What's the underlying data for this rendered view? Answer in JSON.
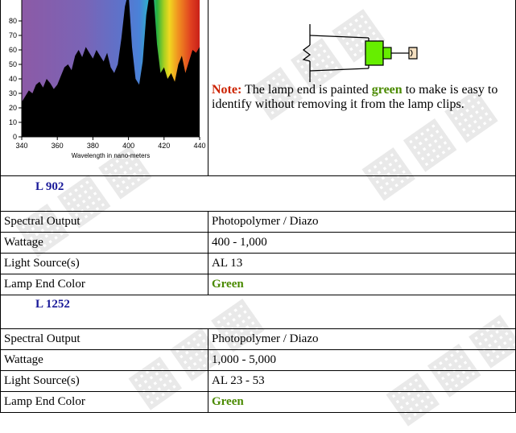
{
  "chart_data": {
    "type": "area",
    "title": "",
    "xlabel": "Wavelength in nano-meters",
    "ylabel": "",
    "xlim": [
      340,
      440
    ],
    "ylim": [
      0,
      100
    ],
    "xticks": [
      340,
      360,
      380,
      400,
      420,
      440
    ],
    "yticks": [
      0,
      10,
      20,
      30,
      40,
      50,
      60,
      70,
      80
    ],
    "x": [
      340,
      342,
      344,
      346,
      348,
      350,
      352,
      354,
      356,
      358,
      360,
      362,
      364,
      366,
      368,
      370,
      372,
      374,
      376,
      378,
      380,
      382,
      384,
      386,
      388,
      390,
      392,
      394,
      396,
      398,
      400,
      402,
      404,
      406,
      408,
      410,
      412,
      414,
      416,
      418,
      420,
      422,
      424,
      426,
      428,
      430,
      432,
      434,
      436,
      438,
      440
    ],
    "y": [
      24,
      28,
      32,
      30,
      36,
      38,
      34,
      40,
      37,
      33,
      36,
      42,
      48,
      50,
      46,
      56,
      60,
      55,
      62,
      58,
      54,
      60,
      56,
      52,
      58,
      48,
      44,
      50,
      68,
      90,
      100,
      62,
      40,
      36,
      52,
      84,
      100,
      100,
      64,
      44,
      48,
      40,
      44,
      38,
      50,
      56,
      44,
      52,
      60,
      58,
      62
    ]
  },
  "note": {
    "label": "Note:",
    "text_before": " The lamp end is painted ",
    "highlight": "green",
    "text_after": " to make is easy to identify without removing it from the lamp clips."
  },
  "sections": [
    {
      "title": "L 902",
      "rows": [
        {
          "label": "Spectral Output",
          "value": "Photopolymer / Diazo"
        },
        {
          "label": "Wattage",
          "value": "400 - 1,000"
        },
        {
          "label": "Light Source(s)",
          "value": "AL 13"
        },
        {
          "label": "Lamp End Color",
          "value": "Green"
        }
      ]
    },
    {
      "title": "L 1252",
      "rows": [
        {
          "label": "Spectral Output",
          "value": "Photopolymer / Diazo"
        },
        {
          "label": "Wattage",
          "value": "1,000 - 5,000"
        },
        {
          "label": "Light Source(s)",
          "value": "AL 23 - 53"
        },
        {
          "label": "Lamp End Color",
          "value": "Green"
        }
      ]
    }
  ],
  "colors": {
    "accent_green": "#4a8a00",
    "note_red": "#cc2200",
    "title_blue": "#1a1a99"
  }
}
